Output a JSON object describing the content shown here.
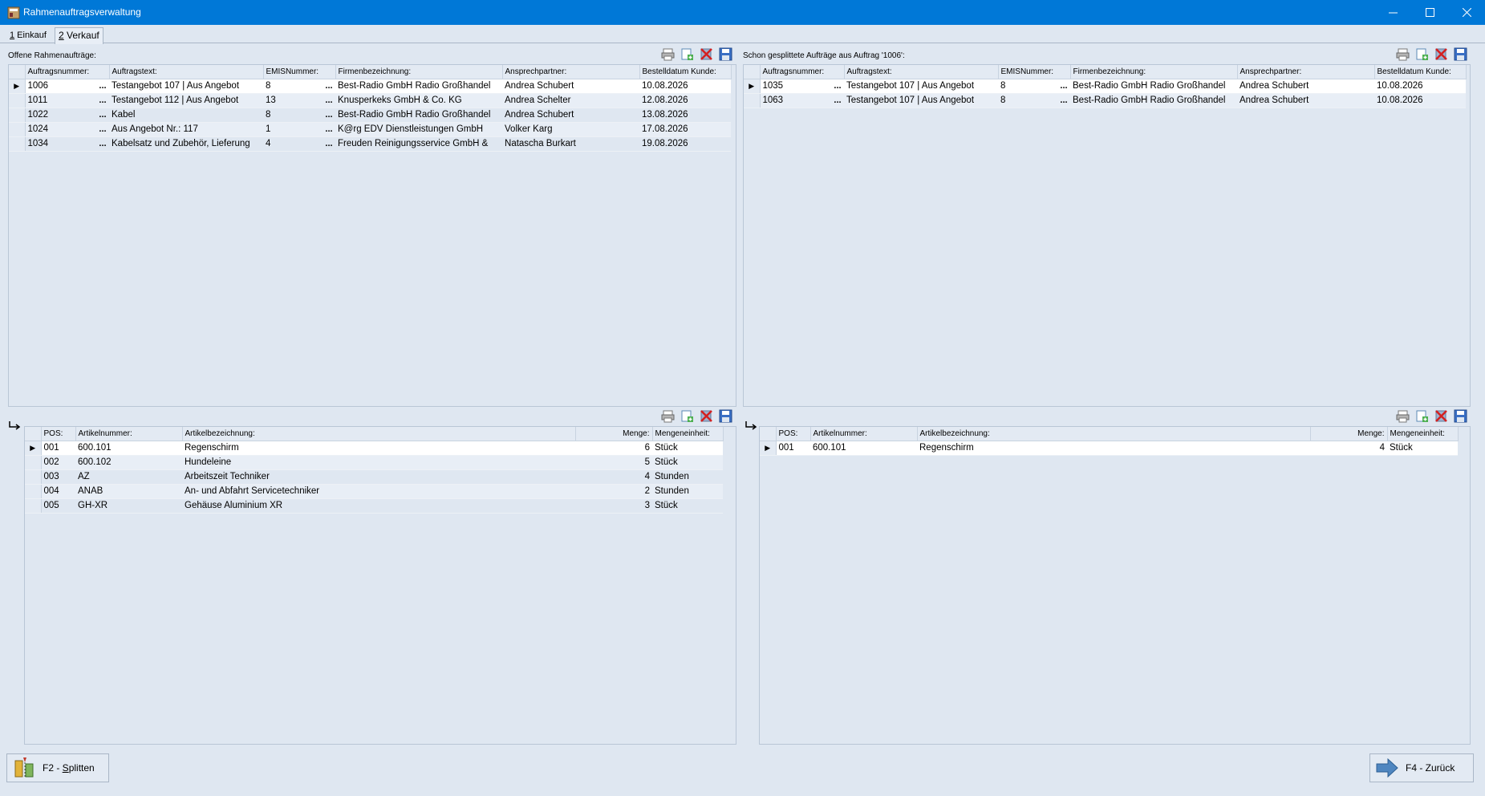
{
  "window": {
    "title": "Rahmenauftragsverwaltung",
    "minimize": "—",
    "maximize": "☐",
    "close": "✕"
  },
  "tabs": [
    {
      "hotkey": "1",
      "label": " Einkauf"
    },
    {
      "hotkey": "2",
      "label": " Verkauf"
    }
  ],
  "left_orders": {
    "label": "Offene Rahmenaufträge:",
    "headers": [
      "Auftragsnummer:",
      "Auftragstext:",
      "EMISNummer:",
      "Firmenbezeichnung:",
      "Ansprechpartner:",
      "Bestelldatum Kunde:"
    ],
    "rows": [
      {
        "nr": "1006",
        "text": "Testangebot 107 | Aus Angebot",
        "emis": "8",
        "firma": "Best-Radio GmbH Radio Großhandel",
        "ansprech": "Andrea Schubert",
        "datum": "10.08.2026"
      },
      {
        "nr": "1011",
        "text": "Testangebot 112 | Aus Angebot",
        "emis": "13",
        "firma": "Knusperkeks GmbH & Co. KG",
        "ansprech": "Andrea Schelter",
        "datum": "12.08.2026"
      },
      {
        "nr": "1022",
        "text": "Kabel",
        "emis": "8",
        "firma": "Best-Radio GmbH Radio Großhandel",
        "ansprech": "Andrea Schubert",
        "datum": "13.08.2026"
      },
      {
        "nr": "1024",
        "text": "Aus Angebot Nr.: 117",
        "emis": "1",
        "firma": "K@rg EDV Dienstleistungen GmbH",
        "ansprech": "Volker Karg",
        "datum": "17.08.2026"
      },
      {
        "nr": "1034",
        "text": "Kabelsatz und Zubehör, Lieferung",
        "emis": "4",
        "firma": "Freuden Reinigungsservice GmbH &",
        "ansprech": "Natascha Burkart",
        "datum": "19.08.2026"
      }
    ]
  },
  "right_orders": {
    "label": "Schon gesplittete Aufträge aus Auftrag '1006':",
    "headers": [
      "Auftragsnummer:",
      "Auftragstext:",
      "EMISNummer:",
      "Firmenbezeichnung:",
      "Ansprechpartner:",
      "Bestelldatum Kunde:"
    ],
    "rows": [
      {
        "nr": "1035",
        "text": "Testangebot 107 | Aus Angebot",
        "emis": "8",
        "firma": "Best-Radio GmbH Radio Großhandel",
        "ansprech": "Andrea Schubert",
        "datum": "10.08.2026"
      },
      {
        "nr": "1063",
        "text": "Testangebot 107 | Aus Angebot",
        "emis": "8",
        "firma": "Best-Radio GmbH Radio Großhandel",
        "ansprech": "Andrea Schubert",
        "datum": "10.08.2026"
      }
    ]
  },
  "left_positions": {
    "headers": [
      "POS:",
      "Artikelnummer:",
      "Artikelbezeichnung:",
      "Menge:",
      "Mengeneinheit:"
    ],
    "rows": [
      {
        "pos": "001",
        "art": "600.101",
        "bez": "Regenschirm",
        "menge": "6",
        "einheit": "Stück"
      },
      {
        "pos": "002",
        "art": "600.102",
        "bez": "Hundeleine",
        "menge": "5",
        "einheit": "Stück"
      },
      {
        "pos": "003",
        "art": "AZ",
        "bez": "Arbeitszeit Techniker",
        "menge": "4",
        "einheit": "Stunden"
      },
      {
        "pos": "004",
        "art": "ANAB",
        "bez": "An- und Abfahrt Servicetechniker",
        "menge": "2",
        "einheit": "Stunden"
      },
      {
        "pos": "005",
        "art": "GH-XR",
        "bez": "Gehäuse Aluminium XR",
        "menge": "3",
        "einheit": "Stück"
      }
    ]
  },
  "right_positions": {
    "headers": [
      "POS:",
      "Artikelnummer:",
      "Artikelbezeichnung:",
      "Menge:",
      "Mengeneinheit:"
    ],
    "rows": [
      {
        "pos": "001",
        "art": "600.101",
        "bez": "Regenschirm",
        "menge": "4",
        "einheit": "Stück"
      }
    ]
  },
  "ellipsis": "...",
  "buttons": {
    "split_prefix": "F2 - ",
    "split_hotkey": "S",
    "split_rest": "plitten",
    "back_label": "F4 - Zurück"
  },
  "toolbar_icons": [
    "print-icon",
    "new-record-icon",
    "delete-icon",
    "save-icon"
  ]
}
